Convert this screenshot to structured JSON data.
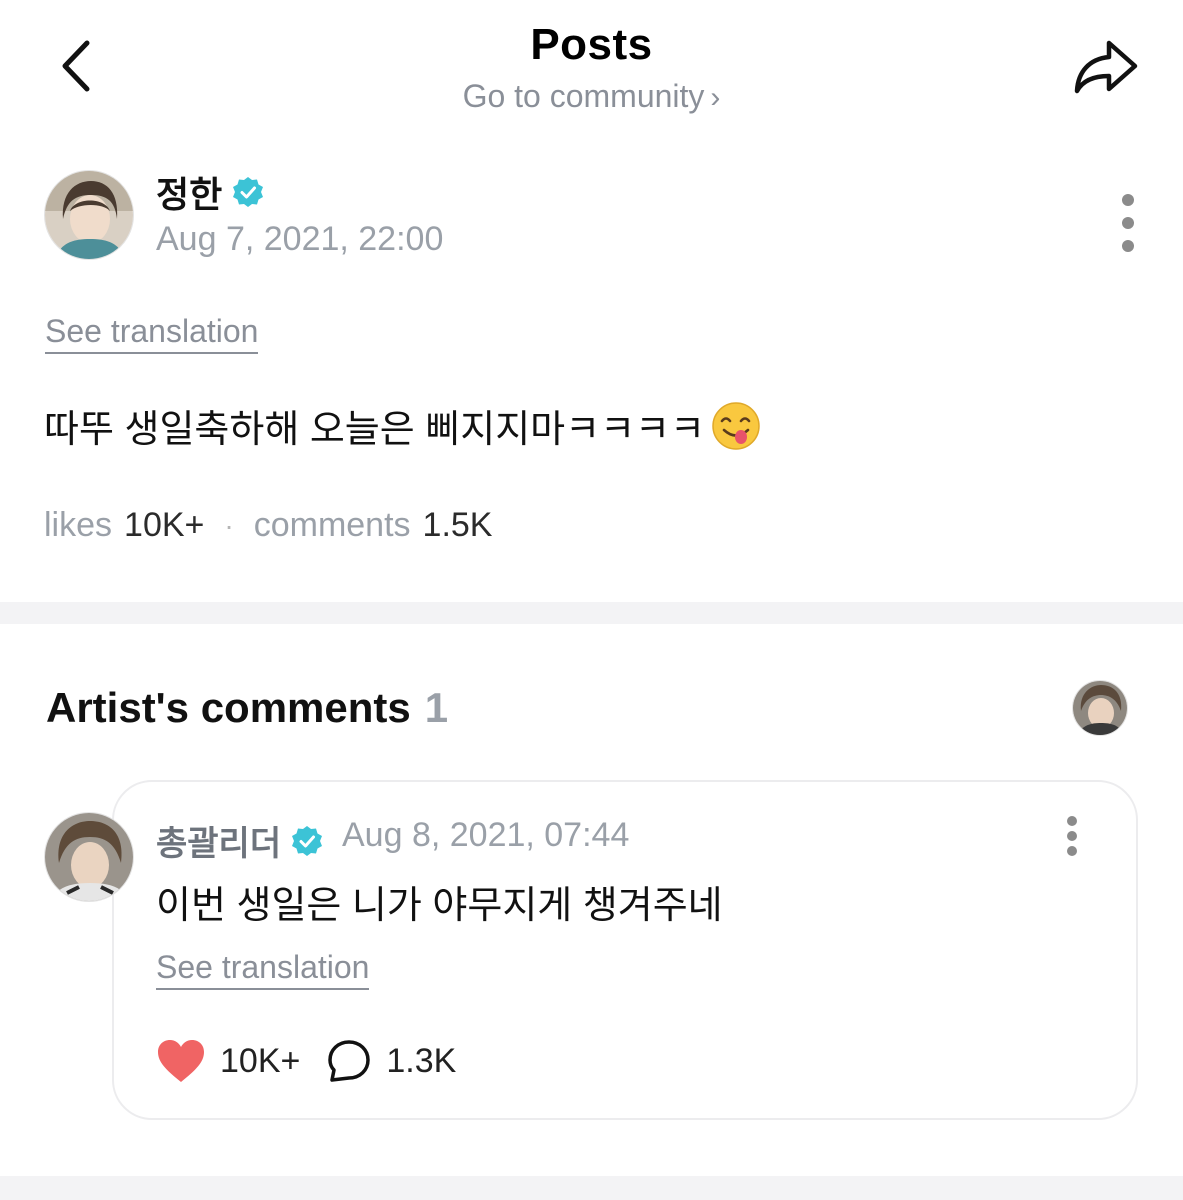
{
  "header": {
    "title": "Posts",
    "community_link": "Go to community",
    "back_icon": "chevron-left-icon",
    "share_icon": "share-arrow-icon"
  },
  "post": {
    "author": "정한",
    "date": "Aug 7, 2021, 22:00",
    "see_translation": "See translation",
    "body": "따뚜 생일축하해 오늘은 삐지지마ㅋㅋㅋㅋ",
    "emoji": "face-savoring-food-emoji",
    "likes_label": "likes",
    "likes_count": "10K+",
    "comments_label": "comments",
    "comments_count": "1.5K"
  },
  "artist_comments": {
    "title": "Artist's comments",
    "count": "1",
    "comment": {
      "author": "총괄리더",
      "date": "Aug 8, 2021, 07:44",
      "text": "이번 생일은 니가 야무지게 챙겨주네",
      "see_translation": "See translation",
      "likes_count": "10K+",
      "replies_count": "1.3K"
    }
  },
  "colors": {
    "verified": "#3cc3d6",
    "heart": "#f06464",
    "muted_text": "#9aa0a8",
    "divider": "#f3f3f5"
  }
}
